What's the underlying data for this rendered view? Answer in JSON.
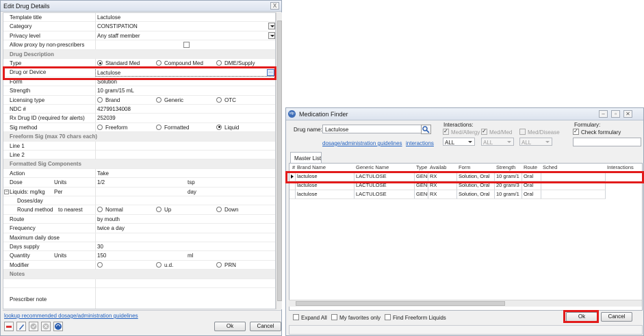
{
  "left": {
    "title": "Edit Drug Details",
    "close": "X",
    "rows": [
      {
        "label": "Template title",
        "value": "Lactulose"
      },
      {
        "label": "Category",
        "value": "CONSTIPATION",
        "dropdown": true
      },
      {
        "label": "Privacy level",
        "value": "Any staff member",
        "dropdown": true
      },
      {
        "label": "Allow proxy by non-prescribers",
        "checkbox": true,
        "checked": false
      },
      {
        "label": "Drug Description",
        "section": true
      },
      {
        "label": "Type",
        "radios": [
          {
            "label": "Standard Med",
            "on": true
          },
          {
            "label": "Compound Med",
            "on": false
          },
          {
            "label": "DME/Supply",
            "on": false
          }
        ]
      },
      {
        "label": "Drug or Device",
        "value": "Lactulose",
        "lookup": true
      },
      {
        "label": "Form",
        "value": "Solution"
      },
      {
        "label": "Strength",
        "value": "10 gram/15 mL"
      },
      {
        "label": "Licensing type",
        "radios": [
          {
            "label": "Brand",
            "on": false
          },
          {
            "label": "Generic",
            "on": false
          },
          {
            "label": "OTC",
            "on": false
          }
        ]
      },
      {
        "label": "NDC #",
        "value": "42799134008"
      },
      {
        "label": "Rx Drug ID (required for alerts)",
        "value": "252039"
      },
      {
        "label": "Sig method",
        "radios": [
          {
            "label": "Freeform",
            "on": false
          },
          {
            "label": "Formatted",
            "on": false
          },
          {
            "label": "Liquid",
            "on": true
          }
        ]
      },
      {
        "label": "Freeform Sig (max 70 chars each)",
        "section": true
      },
      {
        "label": "Line 1",
        "value": ""
      },
      {
        "label": "Line 2",
        "value": ""
      },
      {
        "label": "Formatted Sig Components",
        "section": true
      },
      {
        "label": "Action",
        "value": "Take"
      },
      {
        "label": "Dose",
        "sub": "Units",
        "value": "1/2",
        "unit": "tsp"
      },
      {
        "label": "Liquids: mg/kg",
        "sub": "Per",
        "value": "",
        "unit": "day",
        "expander": true
      },
      {
        "label": "Doses/day",
        "value": "",
        "indent": true
      },
      {
        "label": "Round method",
        "sub": "to nearest",
        "radios": [
          {
            "label": "Normal",
            "on": false
          },
          {
            "label": "Up",
            "on": false
          },
          {
            "label": "Down",
            "on": false
          }
        ],
        "indent": true
      },
      {
        "label": "Route",
        "value": "by mouth"
      },
      {
        "label": "Frequency",
        "value": "twice a day"
      },
      {
        "label": "Maximum daily dose",
        "value": ""
      },
      {
        "label": "Days supply",
        "value": "30"
      },
      {
        "label": "Quantity",
        "sub": "Units",
        "value": "150",
        "unit": "ml"
      },
      {
        "label": "Modifier",
        "radios": [
          {
            "label": "",
            "on": false
          },
          {
            "label": "u.d.",
            "on": false
          },
          {
            "label": "PRN",
            "on": false
          }
        ]
      },
      {
        "label": "Notes",
        "section": true
      },
      {
        "label": "",
        "value": ""
      },
      {
        "label": "Prescriber note",
        "value": "",
        "tall": true
      }
    ],
    "lookup_link": "lookup recommended dosage/administration guidelines",
    "ok": "Ok",
    "cancel": "Cancel"
  },
  "right": {
    "title": "Medication Finder",
    "drug_name_label": "Drug name:",
    "drug_name_value": "Lactulose",
    "link_guidelines": "dosage/administration guidelines",
    "link_interactions": "interactions",
    "interactions_label": "Interactions:",
    "interaction_checks": [
      "Med/Allergy",
      "Med/Med",
      "Med/Disease"
    ],
    "interaction_selects": [
      "ALL",
      "ALL",
      "ALL"
    ],
    "formulary_label": "Formulary:",
    "check_formulary": "Check formulary",
    "tab": "Master List",
    "columns": [
      "#",
      "Brand Name",
      "Generic Name",
      "Type",
      "Availab",
      "Form",
      "Strength",
      "Route",
      "Sched",
      "Interactions"
    ],
    "rows": [
      [
        "lactulose",
        "LACTULOSE",
        "GENE",
        "RX",
        "Solution, Oral",
        "10 gram/1",
        "Oral",
        ""
      ],
      [
        "lactulose",
        "LACTULOSE",
        "GENE",
        "RX",
        "Solution, Oral",
        "20 gram/3",
        "Oral",
        ""
      ],
      [
        "lactulose",
        "LACTULOSE",
        "GENE",
        "RX",
        "Solution, Oral",
        "10 gram/1",
        "Oral",
        ""
      ]
    ],
    "footer_checks": [
      "Expand All",
      "My favorites only",
      "Find Freeform Liquids"
    ],
    "ok": "Ok",
    "cancel": "Cancel"
  },
  "colors": {
    "highlight": "#e21b1b",
    "link": "#1f5fbf"
  }
}
